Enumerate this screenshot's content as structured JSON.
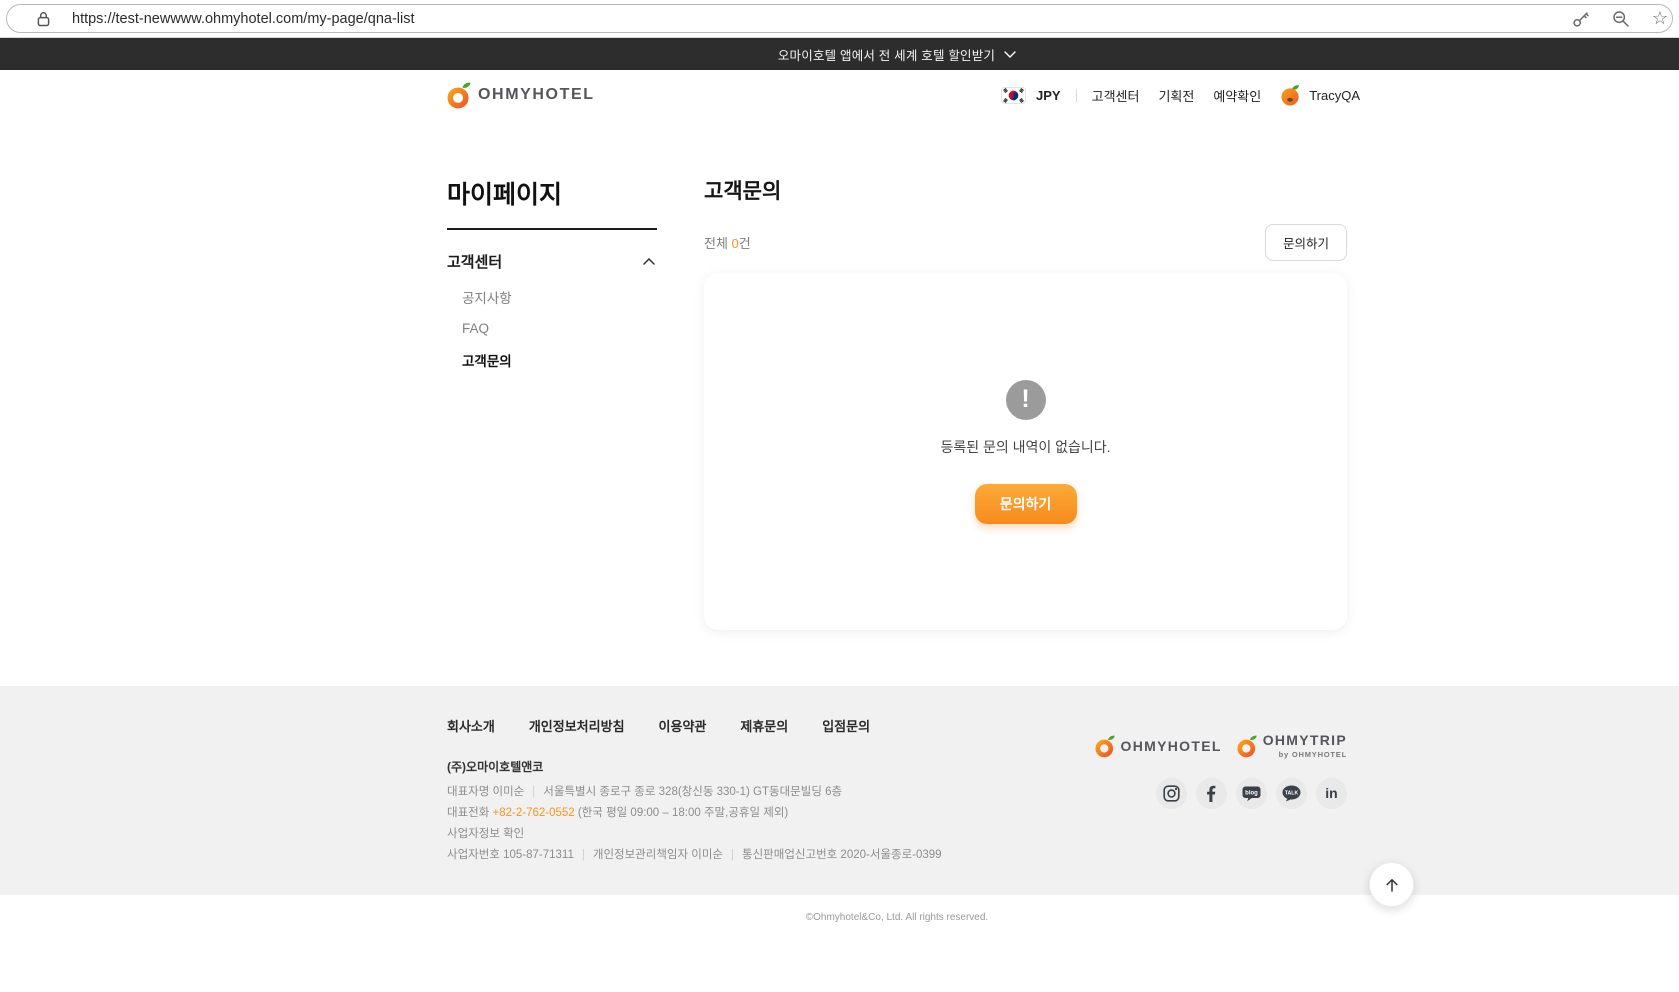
{
  "browser": {
    "url": "https://test-newwww.ohmyhotel.com/my-page/qna-list"
  },
  "banner": {
    "text": "오마이호텔 앱에서 전 세계 호텔 할인받기"
  },
  "header": {
    "brand": "OHMYHOTEL",
    "currency": "JPY",
    "nav": [
      {
        "label": "고객센터"
      },
      {
        "label": "기획전"
      },
      {
        "label": "예약확인"
      }
    ],
    "user": "TracyQA"
  },
  "sidebar": {
    "title": "마이페이지",
    "section": "고객센터",
    "items": [
      {
        "label": "공지사항",
        "active": false
      },
      {
        "label": "FAQ",
        "active": false
      },
      {
        "label": "고객문의",
        "active": true
      }
    ]
  },
  "main": {
    "title": "고객문의",
    "total_prefix": "전체 ",
    "total_count": "0",
    "total_suffix": "건",
    "inquiry_button": "문의하기",
    "empty": {
      "message": "등록된 문의 내역이 없습니다.",
      "button": "문의하기"
    }
  },
  "footer": {
    "links": [
      {
        "label": "회사소개"
      },
      {
        "label": "개인정보처리방침"
      },
      {
        "label": "이용약관"
      },
      {
        "label": "제휴문의"
      },
      {
        "label": "입점문의"
      }
    ],
    "company": "(주)오마이호텔앤코",
    "ceo": "대표자명 이미순",
    "address": "서울특별시 종로구 종로 328(창신동 330-1) GT동대문빌딩 6층",
    "phone_label": "대표전화 ",
    "phone": "+82-2-762-0552",
    "phone_note": " (한국 평일 09:00 – 18:00 주말,공휴일 제외)",
    "biz_info_check": "사업자정보 확인",
    "biz_no": "사업자번호 105-87-71311",
    "privacy_officer": "개인정보관리책임자 이미순",
    "sales_no": "통신판매업신고번호 2020-서울종로-0399",
    "brand1": "OHMYHOTEL",
    "brand2": "OHMYTRIP",
    "brand2_sub": "by OHMYHOTEL",
    "social": [
      "instagram",
      "facebook",
      "naver-blog",
      "kakao-talk",
      "linkedin"
    ],
    "copyright": "©Ohmyhotel&Co, Ltd. All rights reserved."
  },
  "colors": {
    "accent": "#f7941d",
    "banner_bg": "#2d2d2d",
    "footer_bg": "#f1f1f1"
  }
}
